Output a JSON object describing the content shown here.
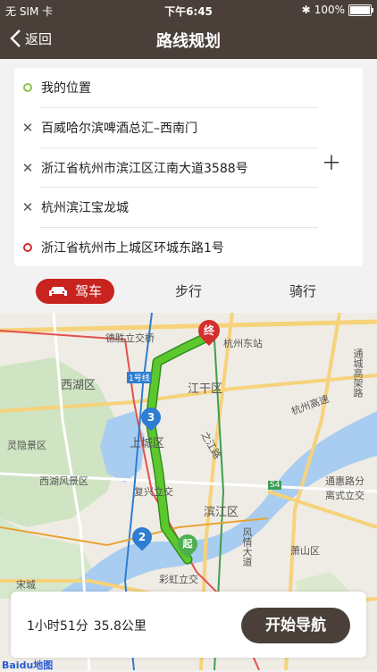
{
  "status": {
    "carrier": "无 SIM 卡",
    "time": "下午6:45",
    "battery": "100%"
  },
  "nav": {
    "back_label": "返回",
    "title": "路线规划"
  },
  "route": {
    "start": "我的位置",
    "waypoints": [
      "百威哈尔滨啤酒总汇–西南门",
      "浙江省杭州市滨江区江南大道3588号",
      "杭州滨江宝龙城"
    ],
    "destination": "浙江省杭州市上城区环城东路1号"
  },
  "modes": {
    "drive": "驾车",
    "walk": "步行",
    "ride": "骑行"
  },
  "map": {
    "labels": [
      "德胜立交桥",
      "杭州东站",
      "西湖区",
      "江干区",
      "杭州高速",
      "灵隐景区",
      "西湖风景区",
      "上城区",
      "复兴立交",
      "滨江区",
      "通惠路分",
      "离式立交",
      "之江路",
      "风情大道",
      "萧山区",
      "彩虹立交",
      "宋城",
      "通城高架路",
      "1号线",
      "S4"
    ],
    "markers": {
      "end": "终",
      "start": "起",
      "wp2": "2",
      "wp3": "3"
    }
  },
  "summary": {
    "duration": "1小时51分",
    "distance": "35.8公里"
  },
  "start_nav_label": "开始导航",
  "map_logo": "Baidu地图",
  "colors": {
    "header": "#4a4039",
    "accent": "#c8231f",
    "route": "#5cc82e"
  }
}
